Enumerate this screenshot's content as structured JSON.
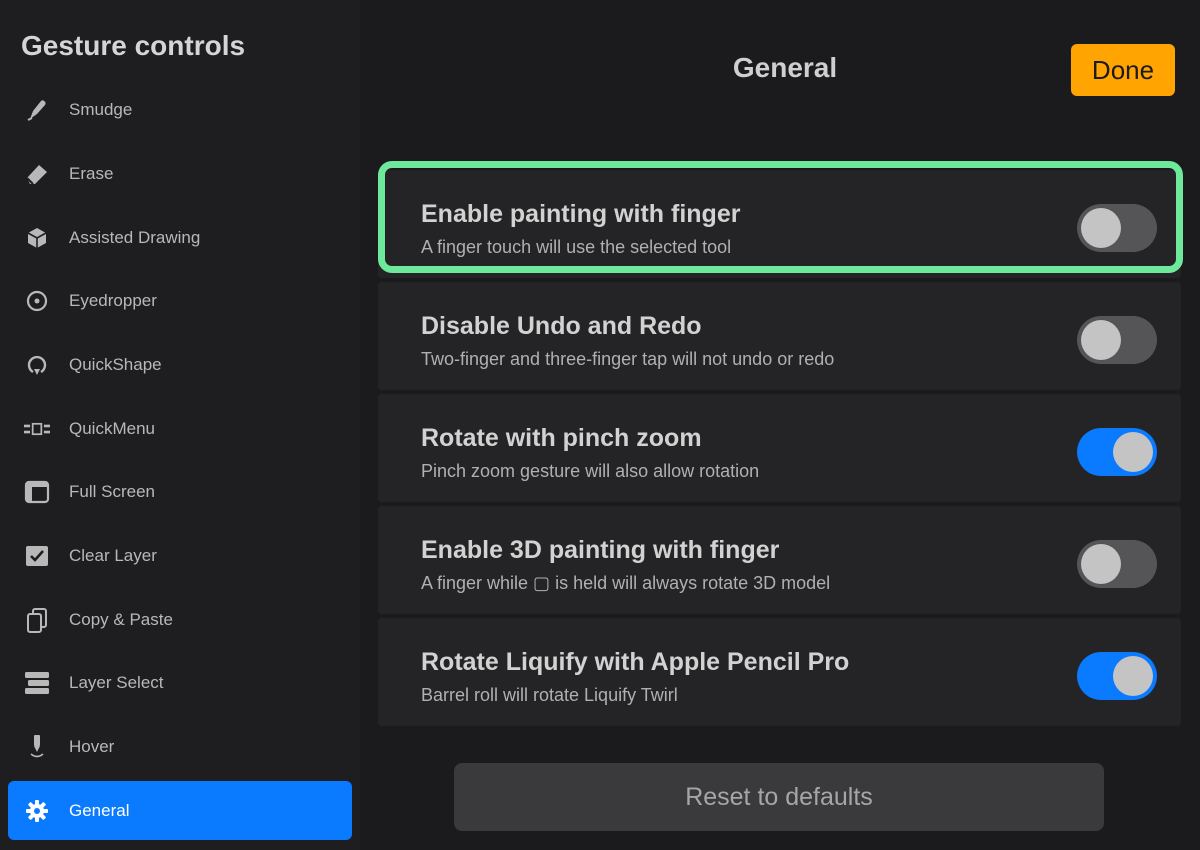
{
  "sidebar": {
    "title": "Gesture controls",
    "items": [
      {
        "label": "Smudge",
        "icon": "smudge-icon"
      },
      {
        "label": "Erase",
        "icon": "eraser-icon"
      },
      {
        "label": "Assisted Drawing",
        "icon": "cube-icon"
      },
      {
        "label": "Eyedropper",
        "icon": "eyedropper-icon"
      },
      {
        "label": "QuickShape",
        "icon": "quickshape-icon"
      },
      {
        "label": "QuickMenu",
        "icon": "quickmenu-icon"
      },
      {
        "label": "Full Screen",
        "icon": "fullscreen-icon"
      },
      {
        "label": "Clear Layer",
        "icon": "clear-layer-icon"
      },
      {
        "label": "Copy & Paste",
        "icon": "copy-paste-icon"
      },
      {
        "label": "Layer Select",
        "icon": "layer-select-icon"
      },
      {
        "label": "Hover",
        "icon": "hover-icon"
      },
      {
        "label": "General",
        "icon": "gear-icon",
        "active": true
      }
    ]
  },
  "header": {
    "title": "General",
    "done_label": "Done"
  },
  "settings": [
    {
      "title": "Enable painting with finger",
      "description": "A finger touch will use the selected tool",
      "enabled": false,
      "highlighted": true
    },
    {
      "title": "Disable Undo and Redo",
      "description": "Two-finger and three-finger tap will not undo or redo",
      "enabled": false
    },
    {
      "title": "Rotate with pinch zoom",
      "description": "Pinch zoom gesture will also allow rotation",
      "enabled": true
    },
    {
      "title": "Enable 3D painting with finger",
      "description": "A finger while ▢ is held will always rotate 3D model",
      "enabled": false
    },
    {
      "title": "Rotate Liquify with Apple Pencil Pro",
      "description": "Barrel roll will rotate Liquify Twirl",
      "enabled": true
    }
  ],
  "reset_label": "Reset to defaults",
  "colors": {
    "accent": "#0a7aff",
    "done": "#ffa400",
    "highlight": "#6ee89b"
  }
}
